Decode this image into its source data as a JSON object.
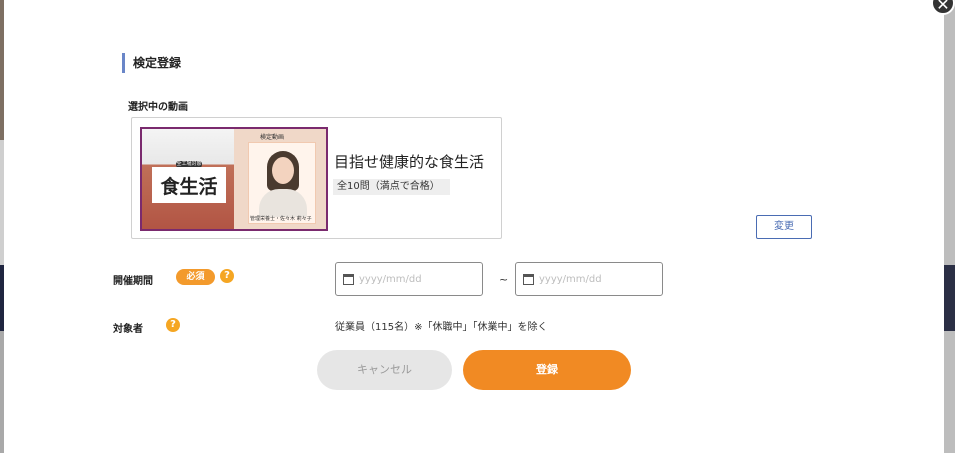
{
  "modal": {
    "title": "検定登録",
    "close_icon": "close-icon"
  },
  "selected_video": {
    "label": "選択中の動画",
    "title": "目指せ健康的な食生活",
    "question_info": "全10問（満点で合格）",
    "thumbnail": {
      "tag": "全工場対象",
      "headline": "食生活",
      "test_label": "検定動画",
      "caption": "管理栄養士・佐々木 莉々子"
    },
    "change_label": "変更"
  },
  "period": {
    "label": "開催期間",
    "required_badge": "必須",
    "help_icon": "question-circle-icon",
    "start_placeholder": "yyyy/mm/dd",
    "end_placeholder": "yyyy/mm/dd",
    "separator": "~",
    "calendar_icon": "calendar-icon"
  },
  "target": {
    "label": "対象者",
    "help_icon": "question-circle-icon",
    "value": "従業員（115名）※「休職中」「休業中」を除く"
  },
  "actions": {
    "cancel_label": "キャンセル",
    "submit_label": "登録"
  },
  "colors": {
    "accent": "#f18a23",
    "title_bar": "#6a86c8",
    "link_blue": "#4a6cb3",
    "help_icon": "#f5a623"
  }
}
